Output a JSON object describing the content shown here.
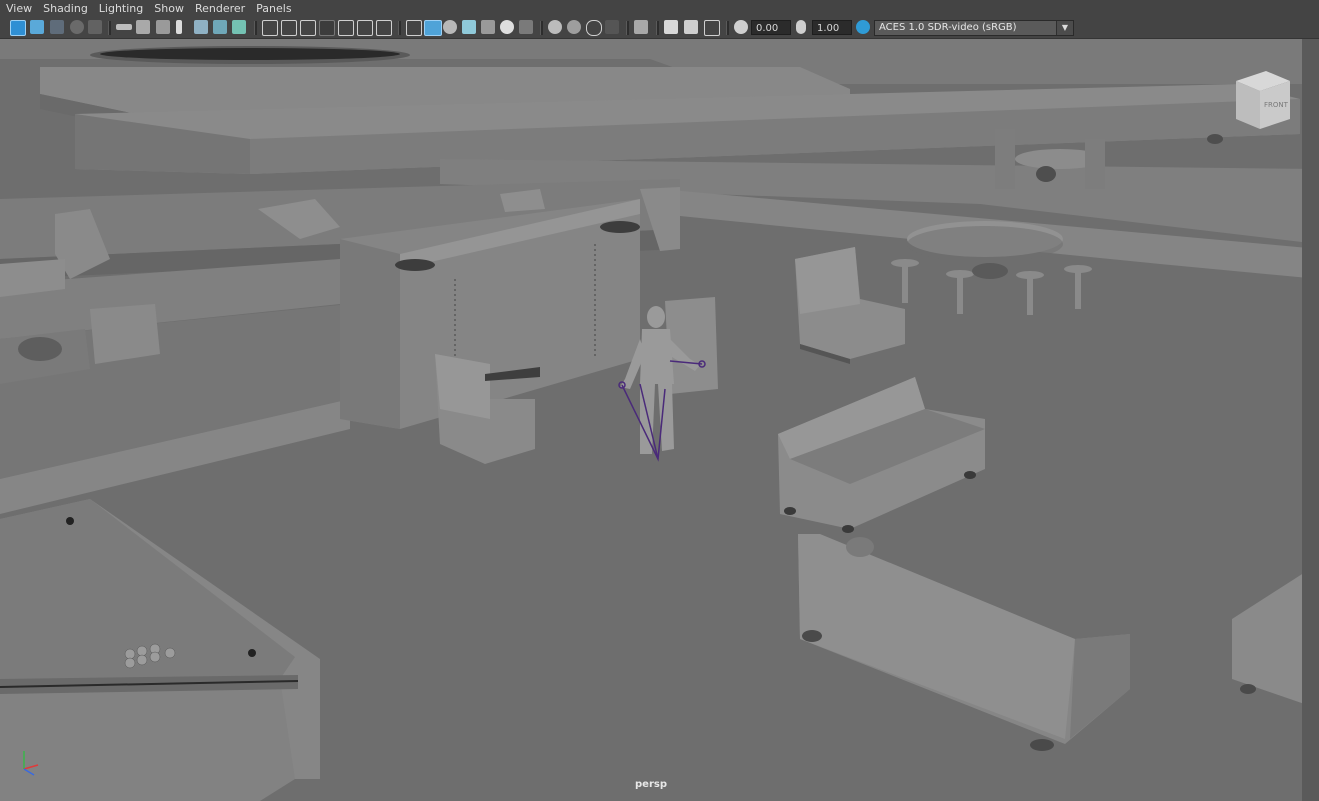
{
  "menu": {
    "items": [
      "View",
      "Shading",
      "Lighting",
      "Show",
      "Renderer",
      "Panels"
    ]
  },
  "toolbar": {
    "exposure_value": "0.00",
    "gamma_value": "1.00",
    "color_space": "ACES 1.0 SDR-video (sRGB)",
    "icons": [
      "select-camera-icon",
      "camera-attributes-icon",
      "bookmarks-icon",
      "image-plane-icon",
      "2d-pan-zoom-icon",
      "grease-pencil-icon",
      "grid-icon",
      "film-gate-icon",
      "resolution-gate-icon",
      "gate-mask-icon",
      "field-chart-icon",
      "safe-action-icon",
      "safe-title-icon",
      "wireframe-icon",
      "smooth-shade-icon",
      "default-material-icon",
      "wireframe-on-shaded-icon",
      "xray-icon",
      "use-lights-icon",
      "shadows-icon",
      "screen-space-ao-icon",
      "motion-blur-icon",
      "anti-aliasing-icon",
      "depth-of-field-icon",
      "isolate-select-icon",
      "xray-joints-icon",
      "xray-active-icon",
      "backface-culling-icon",
      "exposure-icon",
      "gamma-icon",
      "color-management-icon"
    ]
  },
  "viewport": {
    "camera_label": "persp",
    "viewcube_face": "FRONT",
    "colors": {
      "floor": "#6e6e6e",
      "geometry": "#7d7d7d",
      "wall_top": "#8a8a8a",
      "shadow": "#3c3c3c",
      "rig": "#4a2a7a"
    }
  }
}
